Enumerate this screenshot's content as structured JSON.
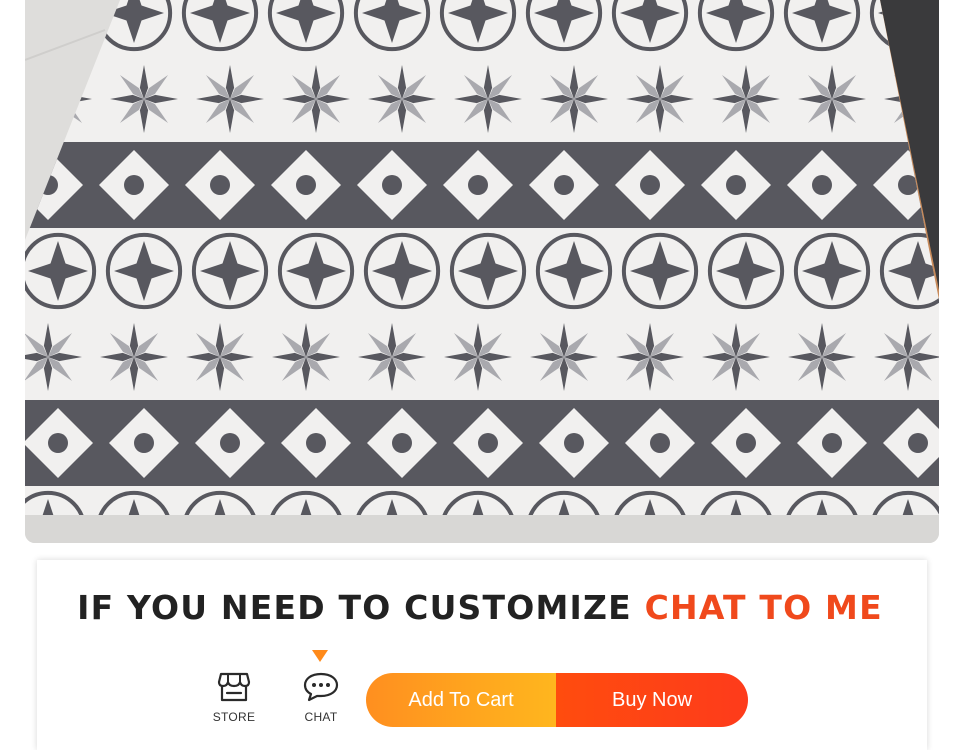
{
  "product_image": {
    "alt": "Patterned rug in grey and white geometric tiles",
    "colors": {
      "dark": "#58585f",
      "mid": "#a9a9ae",
      "light": "#f1f0ef",
      "floor": "#dedddb",
      "trim": "#c78a5a"
    }
  },
  "banner": {
    "headline_main": "IF YOU NEED TO CUSTOMIZE",
    "headline_accent": "CHAT TO ME",
    "accent_color": "#f0491c"
  },
  "action_bar": {
    "store": {
      "label": "STORE",
      "icon": "store-icon"
    },
    "chat": {
      "label": "CHAT",
      "icon": "chat-icon"
    },
    "add_to_cart": "Add To Cart",
    "buy_now": "Buy Now",
    "colors": {
      "cart": "#ff9e1f",
      "buy": "#ff4514",
      "arrow": "#ff8a1a"
    }
  }
}
